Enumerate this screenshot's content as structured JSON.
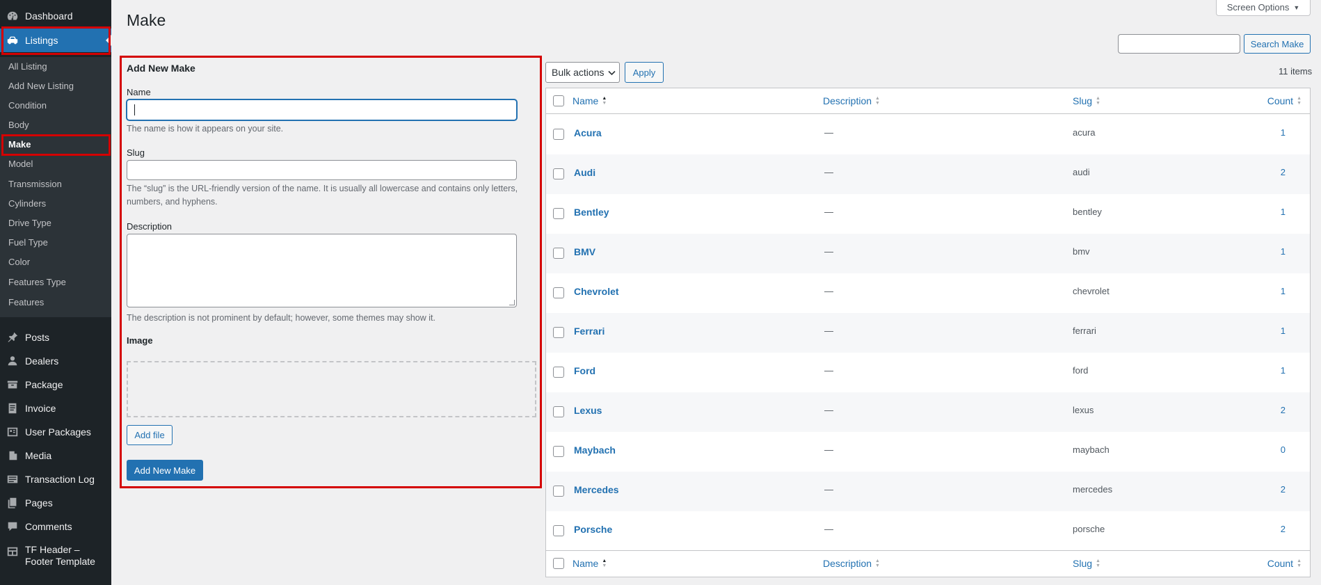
{
  "sidebar": {
    "dashboard": "Dashboard",
    "listings": "Listings",
    "submenu": [
      "All Listing",
      "Add New Listing",
      "Condition",
      "Body",
      "Make",
      "Model",
      "Transmission",
      "Cylinders",
      "Drive Type",
      "Fuel Type",
      "Color",
      "Features Type",
      "Features"
    ],
    "current_sub": "Make",
    "menu": [
      "Posts",
      "Dealers",
      "Package",
      "Invoice",
      "User Packages",
      "Media",
      "Transaction Log",
      "Pages",
      "Comments"
    ],
    "tf_header_line1": "TF Header –",
    "tf_header_line2": "Footer Template",
    "accent": "#2271b1",
    "highlight": "#d40000"
  },
  "header": {
    "title": "Make",
    "screen_options": "Screen Options",
    "search_placeholder": "",
    "search_button": "Search Make"
  },
  "form": {
    "heading": "Add New Make",
    "name_label": "Name",
    "name_value": "",
    "name_help": "The name is how it appears on your site.",
    "slug_label": "Slug",
    "slug_value": "",
    "slug_help": "The “slug” is the URL-friendly version of the name. It is usually all lowercase and contains only letters, numbers, and hyphens.",
    "description_label": "Description",
    "description_value": "",
    "description_help": "The description is not prominent by default; however, some themes may show it.",
    "image_label": "Image",
    "add_file": "Add file",
    "submit": "Add New Make"
  },
  "bulk": {
    "select": "Bulk actions",
    "apply": "Apply",
    "items": "11 items"
  },
  "table": {
    "columns": {
      "name": "Name",
      "description": "Description",
      "slug": "Slug",
      "count": "Count"
    },
    "rows": [
      {
        "name": "Acura",
        "description": "—",
        "slug": "acura",
        "count": "1"
      },
      {
        "name": "Audi",
        "description": "—",
        "slug": "audi",
        "count": "2"
      },
      {
        "name": "Bentley",
        "description": "—",
        "slug": "bentley",
        "count": "1"
      },
      {
        "name": "BMV",
        "description": "—",
        "slug": "bmv",
        "count": "1"
      },
      {
        "name": "Chevrolet",
        "description": "—",
        "slug": "chevrolet",
        "count": "1"
      },
      {
        "name": "Ferrari",
        "description": "—",
        "slug": "ferrari",
        "count": "1"
      },
      {
        "name": "Ford",
        "description": "—",
        "slug": "ford",
        "count": "1"
      },
      {
        "name": "Lexus",
        "description": "—",
        "slug": "lexus",
        "count": "2"
      },
      {
        "name": "Maybach",
        "description": "—",
        "slug": "maybach",
        "count": "0"
      },
      {
        "name": "Mercedes",
        "description": "—",
        "slug": "mercedes",
        "count": "2"
      },
      {
        "name": "Porsche",
        "description": "—",
        "slug": "porsche",
        "count": "2"
      }
    ]
  }
}
